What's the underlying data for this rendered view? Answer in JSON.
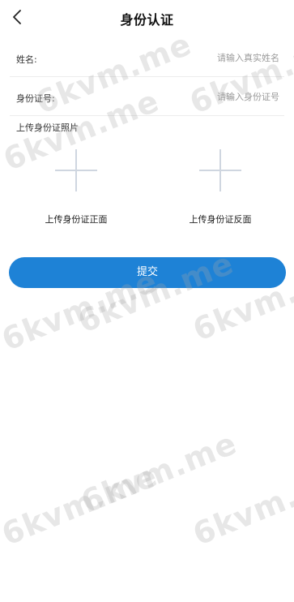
{
  "header": {
    "title": "身份认证",
    "back_icon": "chevron-left-icon"
  },
  "form": {
    "name_label": "姓名:",
    "name_placeholder": "请输入真实姓名",
    "id_label": "身份证号:",
    "id_placeholder": "请输入身份证号"
  },
  "upload": {
    "section_title": "上传身份证照片",
    "front_label": "上传身份证正面",
    "back_label": "上传身份证反面",
    "icon": "plus-icon"
  },
  "submit": {
    "label": "提交",
    "color": "#1e82d6"
  },
  "watermark": {
    "text": "6kvm.me"
  }
}
